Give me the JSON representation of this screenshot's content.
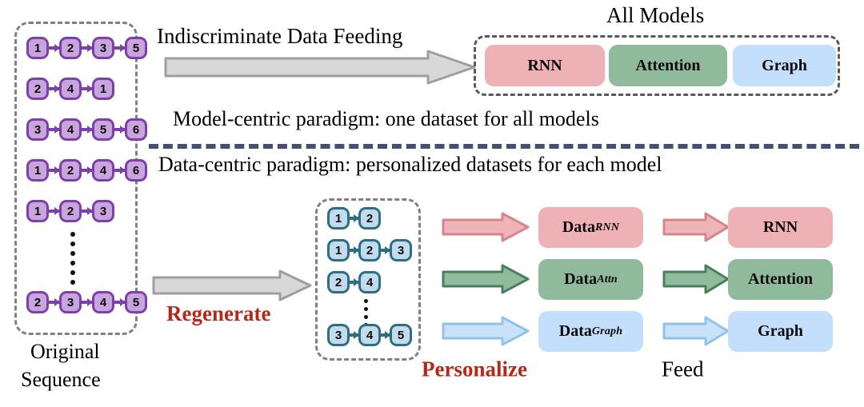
{
  "figure": {
    "title_top": "All Models",
    "feeding_label": "Indiscriminate Data Feeding",
    "model_centric_caption": "Model-centric paradigm: one dataset for all models",
    "data_centric_caption": "Data-centric paradigm: personalized datasets for each model",
    "original_sequence_label_line1": "Original",
    "original_sequence_label_line2": "Sequence",
    "regenerate_label": "Regenerate",
    "personalize_label": "Personalize",
    "feed_label": "Feed"
  },
  "colors": {
    "purple_node_fill": "#c9a5dd",
    "purple_node_border": "#7d3fa8",
    "blue_node_fill": "#c2dcee",
    "blue_node_border": "#2d6f80",
    "pink": "#eeb1b5",
    "pink_border": "#d4868c",
    "green": "#8fbb9c",
    "green_border": "#4e7c5e",
    "lightblue": "#c3dffb",
    "lightblue_border": "#8fbfe6",
    "gray_arrow_fill": "#d6d6d6",
    "gray_arrow_border": "#9a9a9a",
    "divider": "#454f6e",
    "accent_red": "#b82818",
    "dashed_gray": "#808080"
  },
  "original_sequences": [
    {
      "nodes": [
        "1",
        "2",
        "3",
        "5"
      ]
    },
    {
      "nodes": [
        "2",
        "4",
        "1"
      ]
    },
    {
      "nodes": [
        "3",
        "4",
        "5",
        "6"
      ]
    },
    {
      "nodes": [
        "1",
        "2",
        "4",
        "6"
      ]
    },
    {
      "nodes": [
        "1",
        "2",
        "3"
      ]
    },
    {
      "nodes": [
        "2",
        "3",
        "4",
        "5"
      ]
    }
  ],
  "regenerated_sequences": [
    {
      "nodes": [
        "1",
        "2"
      ]
    },
    {
      "nodes": [
        "1",
        "2",
        "3"
      ]
    },
    {
      "nodes": [
        "2",
        "4"
      ]
    },
    {
      "nodes": [
        "3",
        "4",
        "5"
      ]
    }
  ],
  "all_models": [
    {
      "label": "RNN",
      "color": "#eeb1b5"
    },
    {
      "label": "Attention",
      "color": "#8fbb9c"
    },
    {
      "label": "Graph",
      "color": "#c3dffb"
    }
  ],
  "personalized_datasets": [
    {
      "base": "Data",
      "subscript": "RNN",
      "color": "#eeb1b5"
    },
    {
      "base": "Data",
      "subscript": "Attn",
      "color": "#8fbb9c"
    },
    {
      "base": "Data",
      "subscript": "Graph",
      "color": "#c3dffb"
    }
  ],
  "target_models": [
    {
      "label": "RNN",
      "color": "#eeb1b5"
    },
    {
      "label": "Attention",
      "color": "#8fbb9c"
    },
    {
      "label": "Graph",
      "color": "#c3dffb"
    }
  ]
}
